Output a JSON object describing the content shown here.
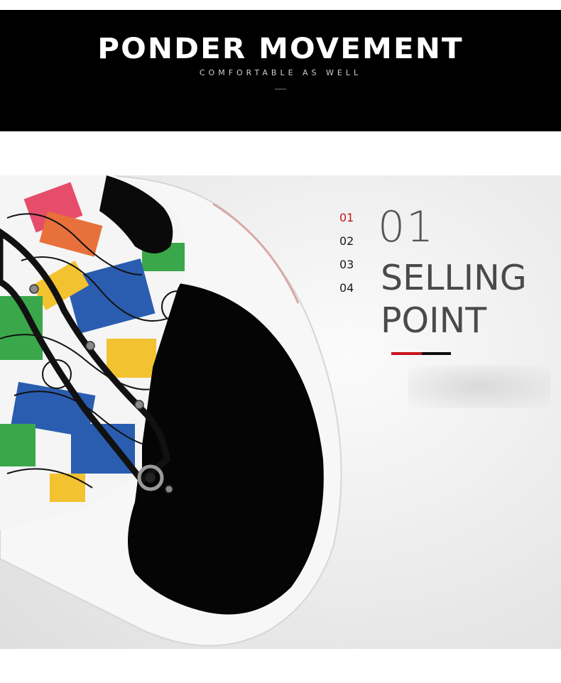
{
  "banner": {
    "title": "PONDER MOVEMENT",
    "subtitle": "COMFORTABLE AS WELL"
  },
  "product_image": {
    "subject": "shoe-toe-closeup",
    "palette": [
      "#000000",
      "#ffffff",
      "#2a5db0",
      "#3aa84a",
      "#f2c230",
      "#e8703a",
      "#e54d6a"
    ]
  },
  "steps": [
    "01",
    "02",
    "03",
    "04"
  ],
  "active_step": "01",
  "feature": {
    "number": "01",
    "line1": "SELLING",
    "line2": "POINT"
  },
  "colors": {
    "accent_red": "#c8141c",
    "accent_black": "#0d0d0d",
    "banner_bg": "#000000"
  }
}
